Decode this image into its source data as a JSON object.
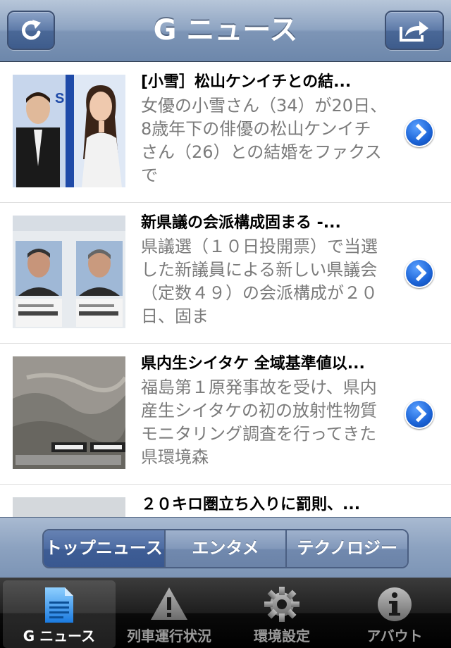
{
  "navbar": {
    "title": "G ニュース",
    "refresh_icon": "refresh-icon",
    "share_icon": "share-icon"
  },
  "news": [
    {
      "title": "[小雪］松山ケンイチとの結...",
      "snippet": "女優の小雪さん（34）が20日、8歳年下の俳優の松山ケンイチさん（26）との結婚をファクスで"
    },
    {
      "title": "新県議の会派構成固まる -...",
      "snippet": "県議選（１０日投開票）で当選した新議員による新しい県議会（定数４９）の会派構成が２０日、固ま"
    },
    {
      "title": "県内生シイタケ 全域基準値以...",
      "snippet": "福島第１原発事故を受け、県内産生シイタケの初の放射性物質モニタリング調査を行ってきた県環境森"
    },
    {
      "title": "２０キロ圏立ち入りに罰則、...",
      "snippet": ""
    }
  ],
  "segments": {
    "items": [
      "トップニュース",
      "エンタメ",
      "テクノロジー"
    ],
    "selected": "トップニュース"
  },
  "tabs": {
    "items": [
      {
        "label": "G ニュース",
        "icon": "document-icon"
      },
      {
        "label": "列車運行状況",
        "icon": "warning-icon"
      },
      {
        "label": "環境設定",
        "icon": "gear-icon"
      },
      {
        "label": "アバウト",
        "icon": "info-icon"
      }
    ],
    "selected": "G ニュース"
  },
  "colors": {
    "accent": "#1b63d6",
    "navbar": "#8ea4c2",
    "snippet_text": "#7b7b7b"
  }
}
